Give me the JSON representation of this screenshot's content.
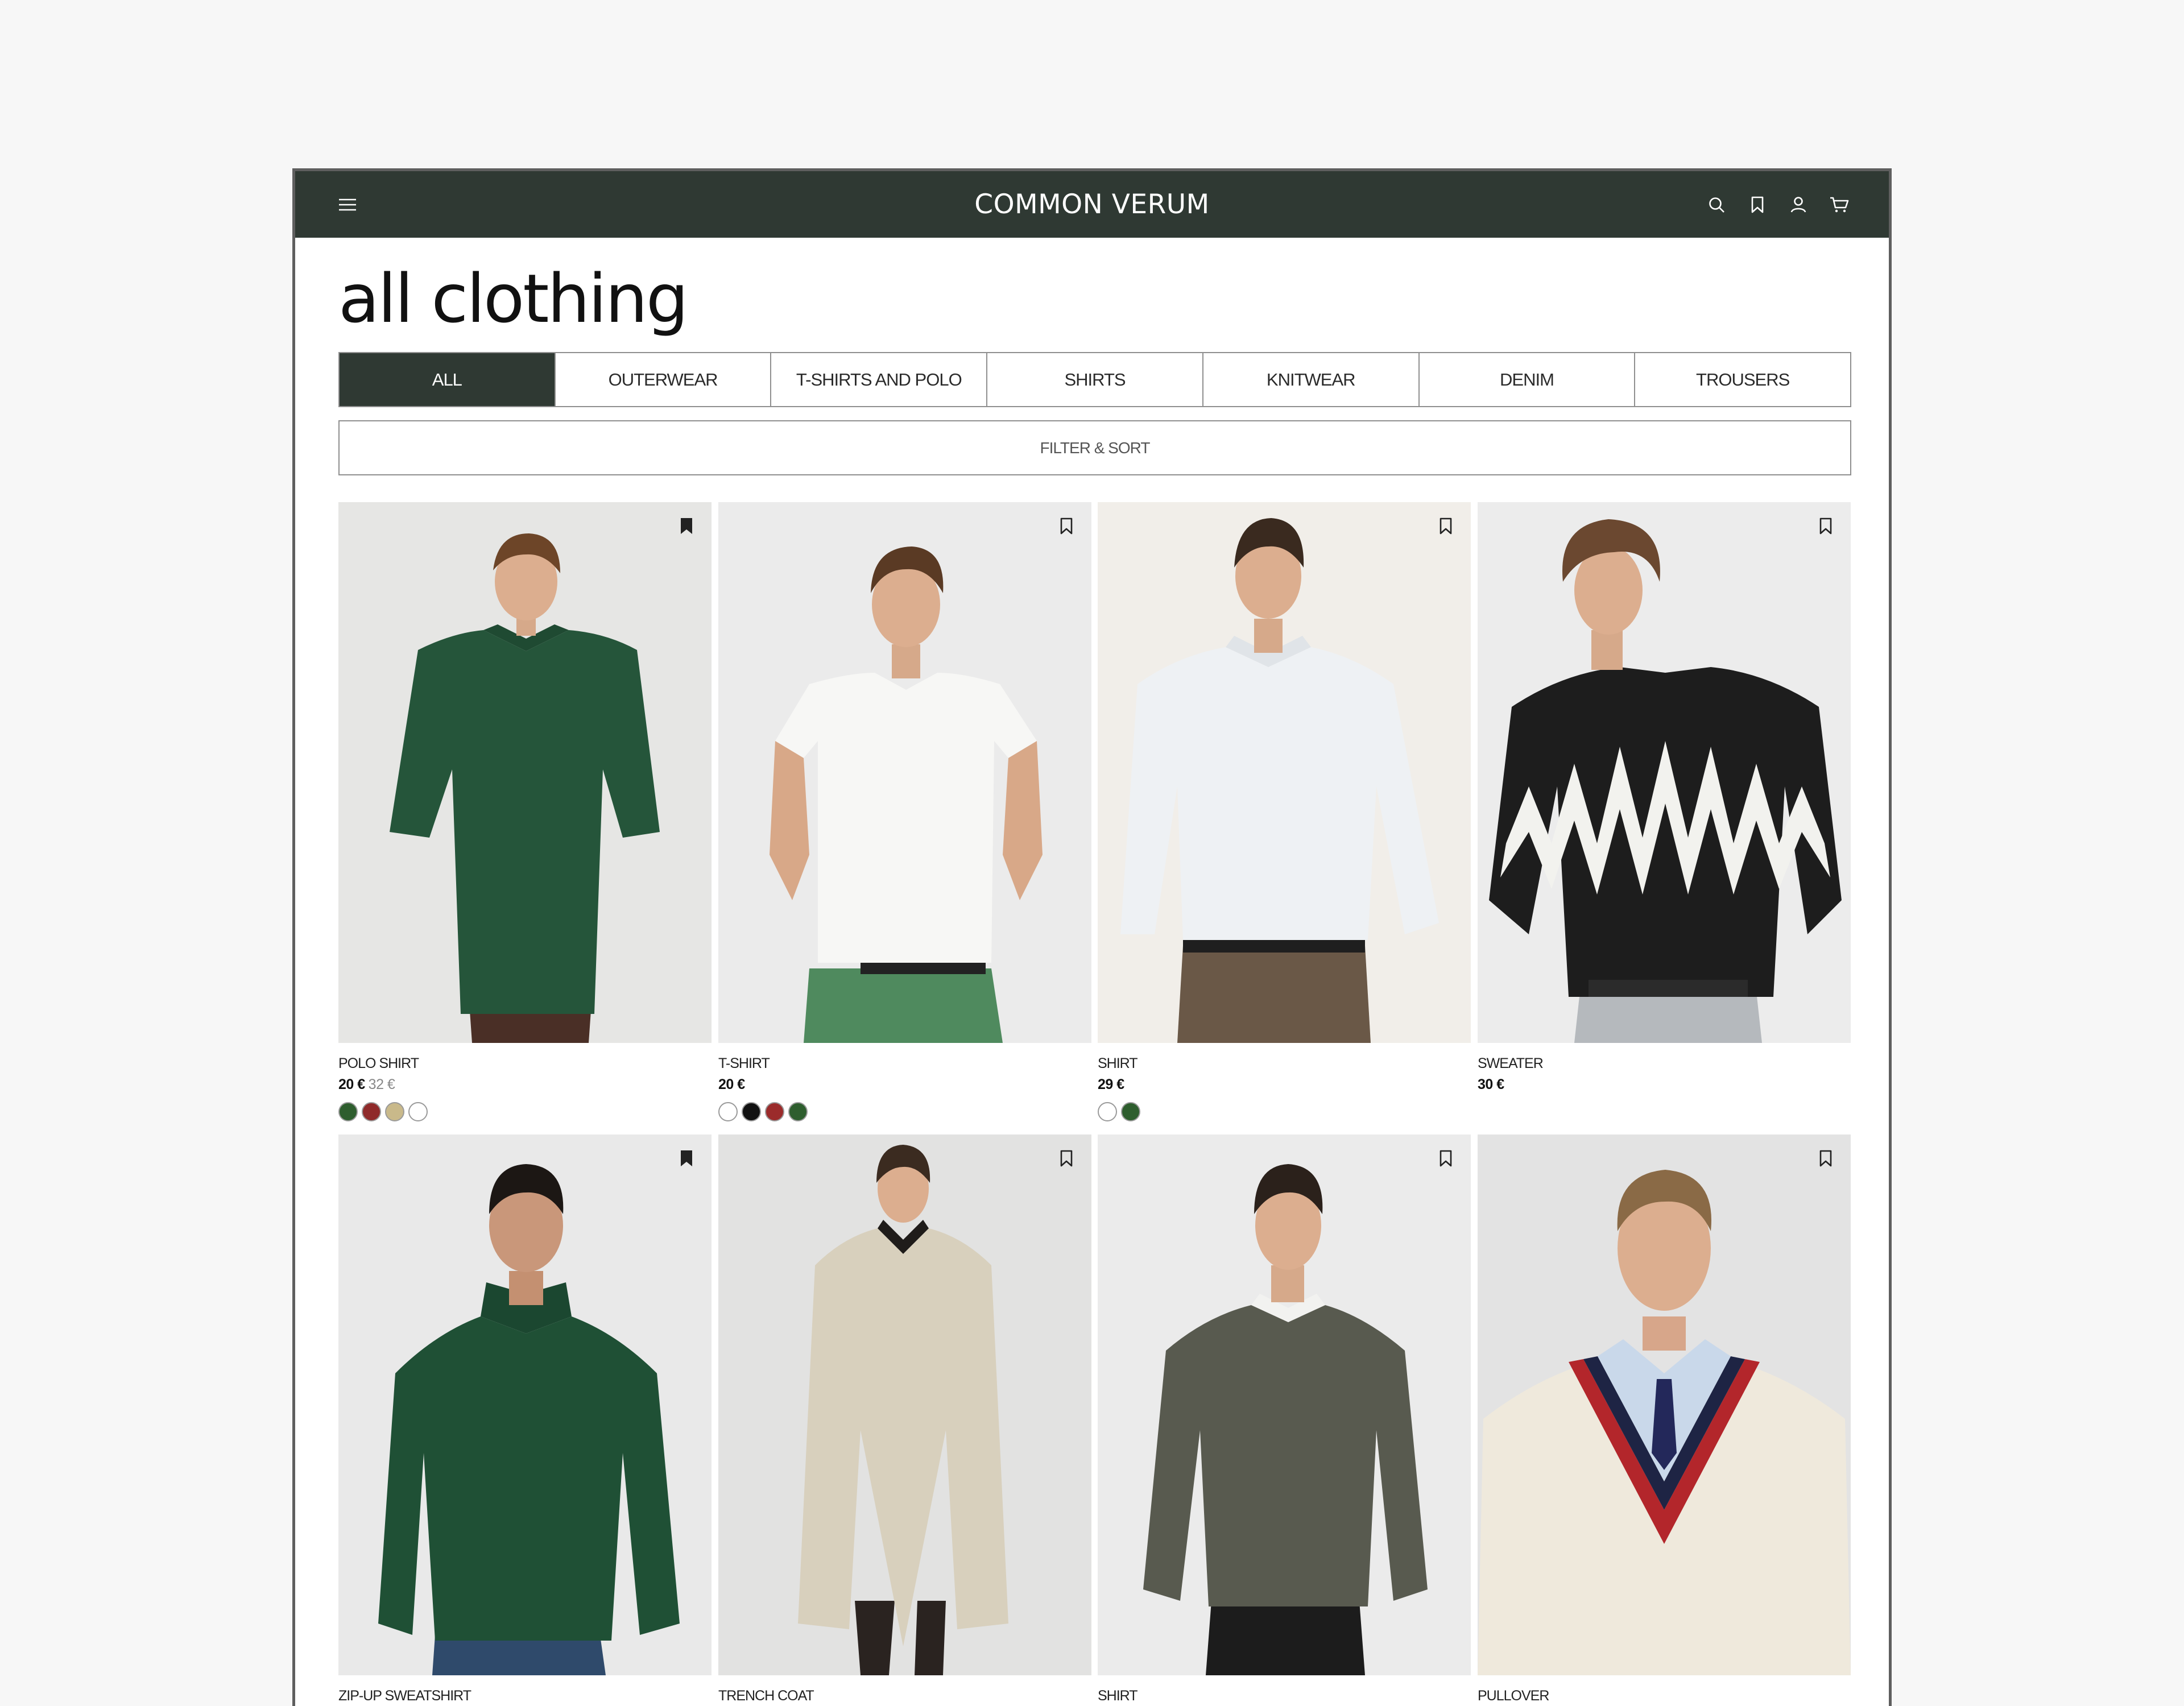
{
  "header": {
    "brand": "COMMON VERUM",
    "icons": [
      "menu-icon",
      "search-icon",
      "bookmark-icon",
      "user-icon",
      "cart-icon"
    ]
  },
  "page": {
    "title": "all clothing"
  },
  "tabs": [
    {
      "label": "ALL",
      "active": true
    },
    {
      "label": "OUTERWEAR"
    },
    {
      "label": "T-SHIRTS AND POLO"
    },
    {
      "label": "SHIRTS"
    },
    {
      "label": "KNITWEAR"
    },
    {
      "label": "DENIM"
    },
    {
      "label": "TROUSERS"
    }
  ],
  "filter": {
    "label": "FILTER & SORT"
  },
  "products": [
    {
      "name": "POLO SHIRT",
      "price": "20 €",
      "old_price": "32 €",
      "swatches": [
        "#2e5e2e",
        "#8f2a2a",
        "#c9b98a",
        "#ffffff"
      ]
    },
    {
      "name": "T-SHIRT",
      "price": "20 €",
      "swatches": [
        "#ffffff",
        "#111111",
        "#9b2b2b",
        "#2e5e2e"
      ]
    },
    {
      "name": "SHIRT",
      "price": "29 €",
      "swatches": [
        "#ffffff",
        "#2e5e2e"
      ]
    },
    {
      "name": "SWEATER",
      "price": "30 €"
    },
    {
      "name": "ZIP-UP SWEATSHIRT"
    },
    {
      "name": "TRENCH COAT"
    },
    {
      "name": "SHIRT"
    },
    {
      "name": "PULLOVER"
    }
  ],
  "colors": {
    "header_bg": "#2f3933",
    "active_tab": "#2f3933"
  }
}
